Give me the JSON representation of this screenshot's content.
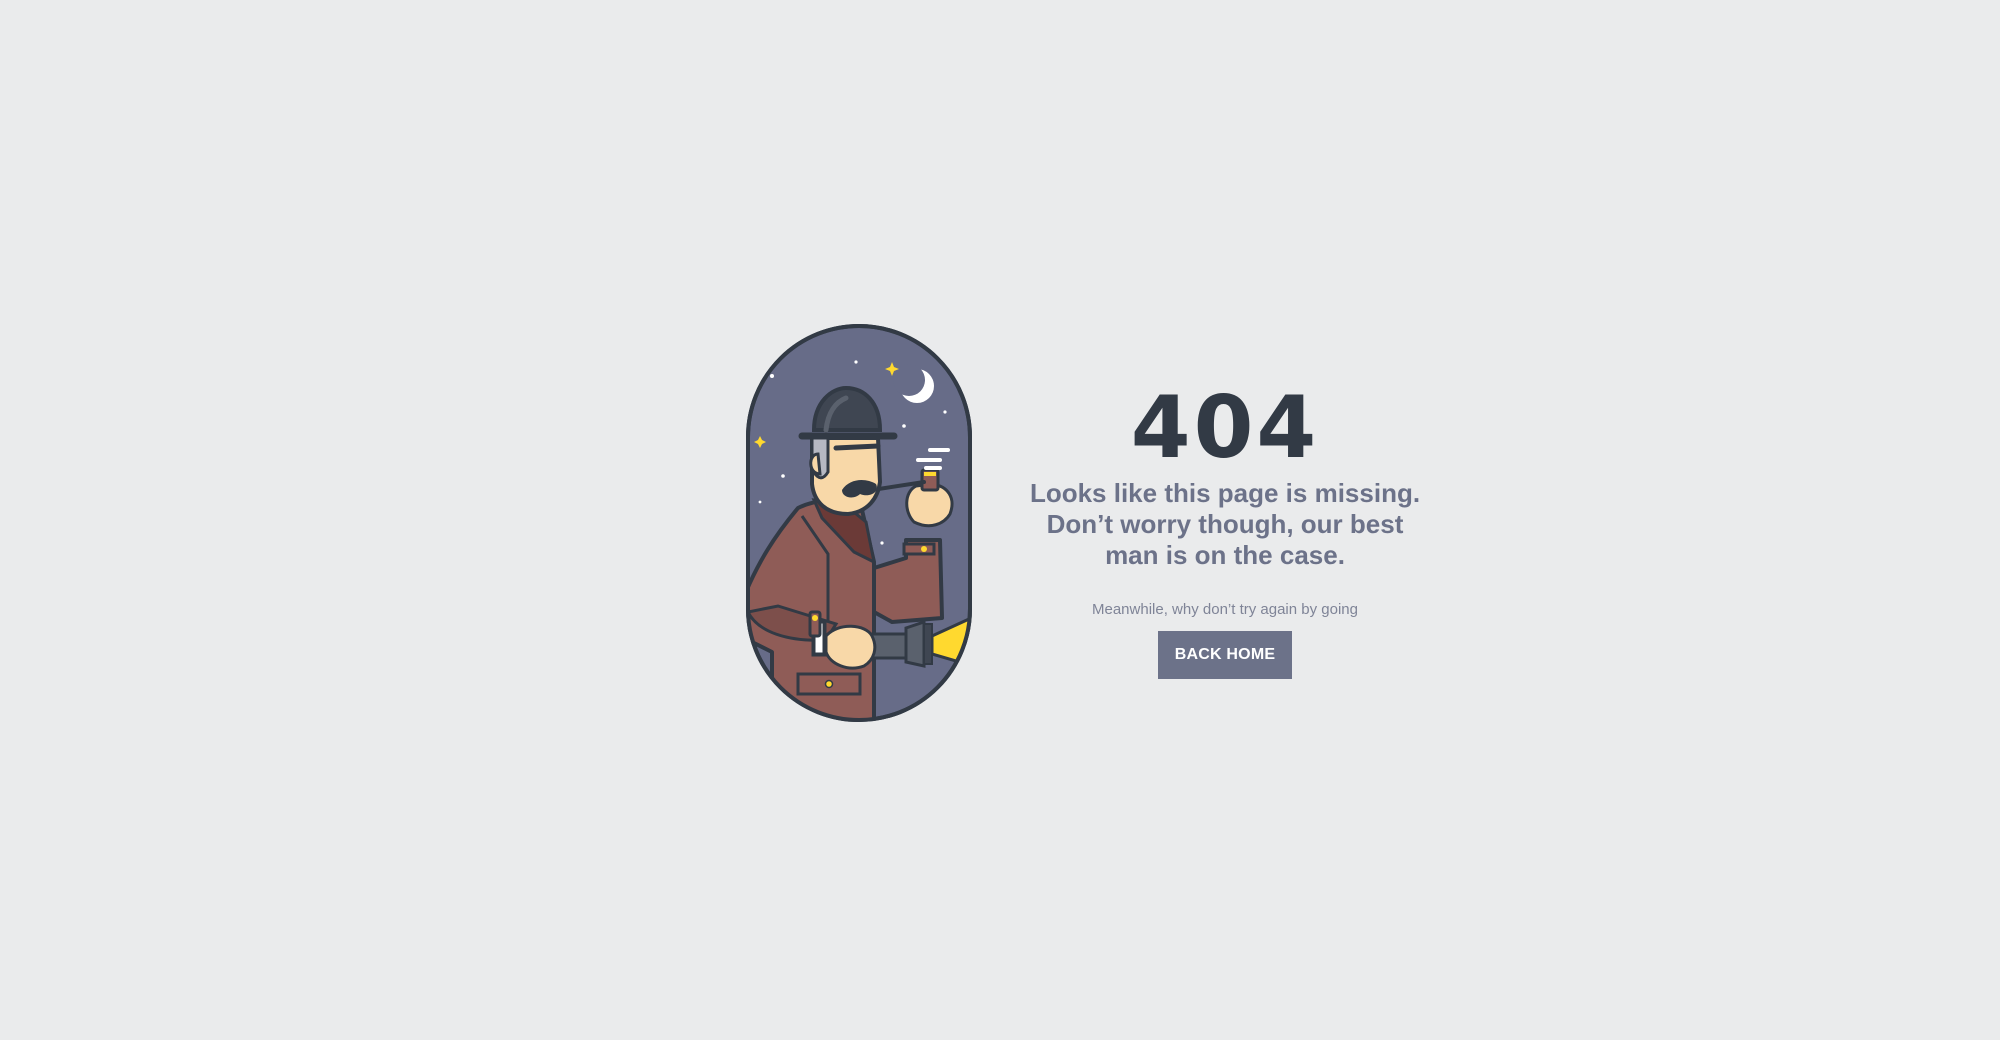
{
  "error": {
    "code": "404",
    "message_lines": [
      "Looks like this page is missing.",
      "Don’t worry though, our best",
      "man is on the case."
    ],
    "suggestion": "Meanwhile, why don’t try again by going",
    "button_label": "BACK HOME"
  },
  "illustration": {
    "subject": "detective-with-pipe-and-flashlight",
    "icons": [
      "moon-icon",
      "star-icon",
      "smoke-icon",
      "flashlight-icon"
    ]
  },
  "colors": {
    "background": "#eaebec",
    "heading": "#323a45",
    "text": "#6c7289",
    "button": "#6c7289",
    "button_text": "#ffffff",
    "night_sky": "#676c88",
    "coat": "#8f5c57",
    "skin": "#f8d8a8",
    "light_beam": "#ffd92f"
  }
}
